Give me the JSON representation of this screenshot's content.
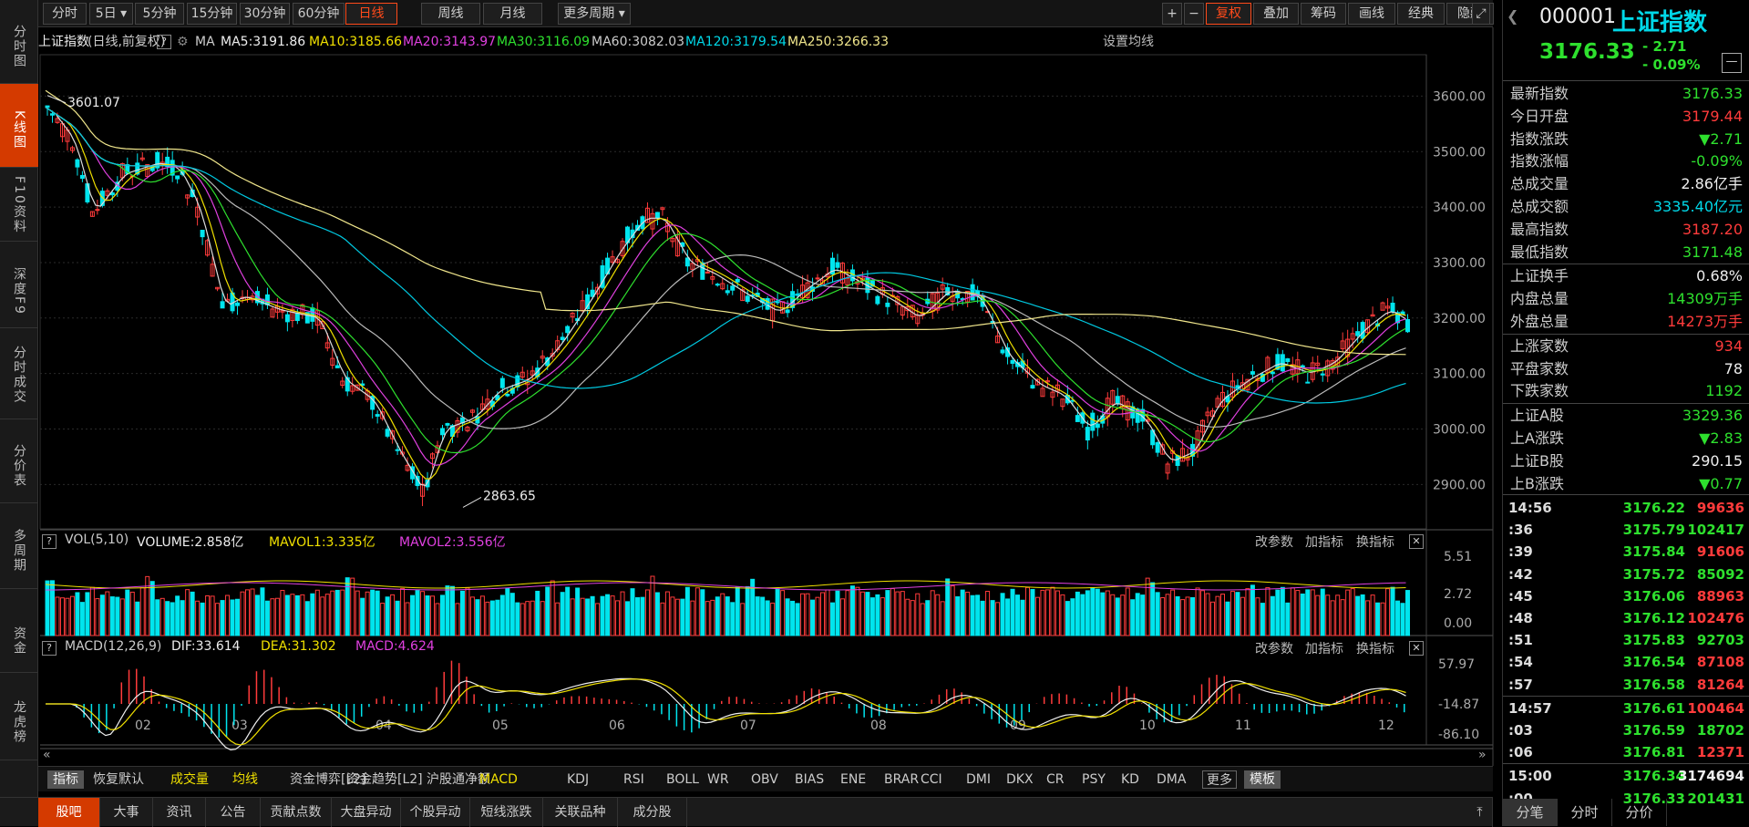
{
  "left_tabs": [
    {
      "label": "分时图"
    },
    {
      "label": "K线图"
    },
    {
      "label": "F10资料"
    },
    {
      "label": "深度F9"
    },
    {
      "label": "分时成交"
    },
    {
      "label": "分价表"
    },
    {
      "label": "多周期"
    },
    {
      "label": "资金"
    },
    {
      "label": "龙虎榜"
    }
  ],
  "period_tabs": [
    "分时",
    "5日",
    "5分钟",
    "15分钟",
    "30分钟",
    "60分钟",
    "日线",
    "周线",
    "月线",
    "更多周期"
  ],
  "toolbar_right": [
    "+",
    "−",
    "复权",
    "叠加",
    "筹码",
    "画线",
    "经典",
    "隐藏"
  ],
  "ma_bar": {
    "name": "上证指数",
    "mode": "(日线,前复权)",
    "ma": "MA",
    "ma5": "MA5:3191.86",
    "ma10": "MA10:3185.66",
    "ma20": "MA20:3143.97",
    "ma30": "MA30:3116.09",
    "ma60": "MA60:3082.03",
    "ma120": "MA120:3179.54",
    "ma250": "MA250:3266.33",
    "settings": "设置均线"
  },
  "price_axis": [
    "3600.00",
    "3500.00",
    "3400.00",
    "3300.00",
    "3200.00",
    "3100.00",
    "3000.00",
    "2900.00"
  ],
  "annotations": {
    "high": "3601.07",
    "low": "2863.65"
  },
  "month_labels": [
    "02",
    "03",
    "04",
    "05",
    "06",
    "07",
    "08",
    "09",
    "10",
    "11",
    "12"
  ],
  "vol_bar": {
    "label": "VOL(5,10)",
    "volume": "VOLUME:2.858亿",
    "mavol1": "MAVOL1:3.335亿",
    "mavol2": "MAVOL2:3.556亿",
    "axis": [
      "5.51",
      "2.72",
      "0.00"
    ]
  },
  "macd_bar": {
    "label": "MACD(12,26,9)",
    "dif": "DIF:33.614",
    "dea": "DEA:31.302",
    "macd": "MACD:4.624",
    "axis": [
      "57.97",
      "-14.87",
      "-86.10"
    ]
  },
  "panel_buttons": [
    "改参数",
    "加指标",
    "换指标"
  ],
  "indicator_tabs": [
    "指标",
    "恢复默认",
    "成交量",
    "均线",
    "资金博弈[L2]",
    "资金趋势[L2]",
    "沪股通净额",
    "MACD",
    "KDJ",
    "RSI",
    "BOLL",
    "WR",
    "OBV",
    "BIAS",
    "ENE",
    "BRAR",
    "CCI",
    "DMI",
    "DKX",
    "CR",
    "PSY",
    "KD",
    "DMA",
    "更多",
    "模板"
  ],
  "bottom_tabs": [
    "股吧",
    "大事",
    "资讯",
    "公告",
    "贡献点数",
    "大盘异动",
    "个股异动",
    "短线涨跌",
    "关联品种",
    "成分股"
  ],
  "quote": {
    "code": "000001",
    "name": "上证指数",
    "price": "3176.33",
    "change": "- 2.71",
    "change_pct": "- 0.09%"
  },
  "stats": [
    {
      "k": "最新指数",
      "v": "3176.33",
      "c": "green"
    },
    {
      "k": "今日开盘",
      "v": "3179.44",
      "c": "red"
    },
    {
      "k": "指数涨跌",
      "v": "▼2.71",
      "c": "green"
    },
    {
      "k": "指数涨幅",
      "v": "-0.09%",
      "c": "green"
    },
    {
      "k": "总成交量",
      "v": "2.86亿手",
      "c": "white"
    },
    {
      "k": "总成交额",
      "v": "3335.40亿元",
      "c": "cyan"
    },
    {
      "k": "最高指数",
      "v": "3187.20",
      "c": "red"
    },
    {
      "k": "最低指数",
      "v": "3171.48",
      "c": "green"
    },
    {
      "k": "上证换手",
      "v": "0.68%",
      "c": "white"
    },
    {
      "k": "内盘总量",
      "v": "14309万手",
      "c": "green"
    },
    {
      "k": "外盘总量",
      "v": "14273万手",
      "c": "red"
    },
    {
      "k": "上涨家数",
      "v": "934",
      "c": "red"
    },
    {
      "k": "平盘家数",
      "v": "78",
      "c": "white"
    },
    {
      "k": "下跌家数",
      "v": "1192",
      "c": "green"
    },
    {
      "k": "上证A股",
      "v": "3329.36",
      "c": "green"
    },
    {
      "k": "上A涨跌",
      "v": "▼2.83",
      "c": "green"
    },
    {
      "k": "上证B股",
      "v": "290.15",
      "c": "white"
    },
    {
      "k": "上B涨跌",
      "v": "▼0.77",
      "c": "green"
    }
  ],
  "ticks": [
    {
      "t": "14:56",
      "p": "3176.22",
      "v": "99636",
      "c": "red",
      "hl": true
    },
    {
      "t": ":36",
      "p": "3175.79",
      "v": "102417",
      "c": "green"
    },
    {
      "t": ":39",
      "p": "3175.84",
      "v": "91606",
      "c": "red"
    },
    {
      "t": ":42",
      "p": "3175.72",
      "v": "85092",
      "c": "green"
    },
    {
      "t": ":45",
      "p": "3176.06",
      "v": "88963",
      "c": "red"
    },
    {
      "t": ":48",
      "p": "3176.12",
      "v": "102476",
      "c": "red"
    },
    {
      "t": ":51",
      "p": "3175.83",
      "v": "92703",
      "c": "green"
    },
    {
      "t": ":54",
      "p": "3176.54",
      "v": "87108",
      "c": "red"
    },
    {
      "t": ":57",
      "p": "3176.58",
      "v": "81264",
      "c": "red"
    },
    {
      "t": "14:57",
      "p": "3176.61",
      "v": "100464",
      "c": "red",
      "hl": true
    },
    {
      "t": ":03",
      "p": "3176.59",
      "v": "18702",
      "c": "green"
    },
    {
      "t": ":06",
      "p": "3176.81",
      "v": "12371",
      "c": "red"
    },
    {
      "t": "15:00",
      "p": "3176.34",
      "v": "3174694",
      "c": "white",
      "hl": true
    },
    {
      "t": ":00",
      "p": "3176.33",
      "v": "201431",
      "c": "green"
    }
  ],
  "right_tabs": [
    "分笔",
    "分时",
    "分价"
  ],
  "colors": {
    "up": "#ff3b3b",
    "down": "#00e5ee",
    "ma5": "#dddddd",
    "ma10": "#f0e000",
    "ma20": "#e040e0",
    "ma30": "#2ee02e",
    "ma60": "#bbbbbb",
    "ma120": "#00c8e0",
    "ma250": "#f0e68c",
    "accent": "#d43a00"
  }
}
